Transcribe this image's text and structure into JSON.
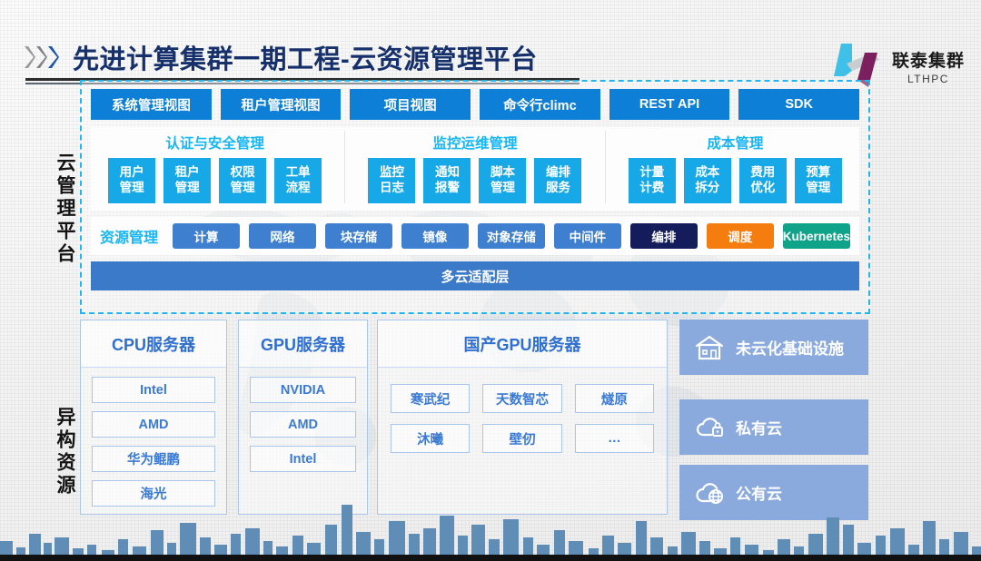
{
  "header": {
    "title": "先进计算集群一期工程-云资源管理平台",
    "chevron_icon": "double-chevron-right-icon",
    "brand_cn": "联泰集群",
    "brand_en": "LTHPC",
    "brand_logo_icon": "lthpc-logo-icon"
  },
  "side_labels": {
    "cloud_platform": "云管理平台",
    "heterogeneous": "异构资源"
  },
  "cloud_platform": {
    "top_nav": [
      {
        "label": "系统管理视图"
      },
      {
        "label": "租户管理视图"
      },
      {
        "label": "项目视图"
      },
      {
        "label": "命令行climc"
      },
      {
        "label": "REST API"
      },
      {
        "label": "SDK"
      }
    ],
    "groups": [
      {
        "title": "认证与安全管理",
        "tiles": [
          {
            "line1": "用户",
            "line2": "管理"
          },
          {
            "line1": "租户",
            "line2": "管理"
          },
          {
            "line1": "权限",
            "line2": "管理"
          },
          {
            "line1": "工单",
            "line2": "流程"
          }
        ]
      },
      {
        "title": "监控运维管理",
        "tiles": [
          {
            "line1": "监控",
            "line2": "日志"
          },
          {
            "line1": "通知",
            "line2": "报警"
          },
          {
            "line1": "脚本",
            "line2": "管理"
          },
          {
            "line1": "编排",
            "line2": "服务"
          }
        ]
      },
      {
        "title": "成本管理",
        "tiles": [
          {
            "line1": "计量",
            "line2": "计费"
          },
          {
            "line1": "成本",
            "line2": "拆分"
          },
          {
            "line1": "费用",
            "line2": "优化"
          },
          {
            "line1": "预算",
            "line2": "管理"
          }
        ]
      }
    ],
    "resource_row": {
      "title": "资源管理",
      "tiles": [
        {
          "label": "计算",
          "color": "#3f7fd0"
        },
        {
          "label": "网络",
          "color": "#3f7fd0"
        },
        {
          "label": "块存储",
          "color": "#3f7fd0"
        },
        {
          "label": "镜像",
          "color": "#3f7fd0"
        },
        {
          "label": "对象存储",
          "color": "#3f7fd0"
        },
        {
          "label": "中间件",
          "color": "#3f7fd0"
        },
        {
          "label": "编排",
          "color": "#141c5c"
        },
        {
          "label": "调度",
          "color": "#f57c0e"
        },
        {
          "label": "Kubernetes",
          "color": "#0fa389"
        }
      ]
    },
    "adaptation_layer": "多云适配层"
  },
  "heterogeneous": {
    "columns": [
      {
        "title": "CPU服务器",
        "chips": [
          "Intel",
          "AMD",
          "华为鲲鹏",
          "海光"
        ]
      },
      {
        "title": "GPU服务器",
        "chips": [
          "NVIDIA",
          "AMD",
          "Intel"
        ]
      },
      {
        "title": "国产GPU服务器",
        "chips": [
          "寒武纪",
          "天数智芯",
          "燧原",
          "沐曦",
          "壁仞",
          "…"
        ]
      }
    ],
    "cloud_cards": [
      {
        "label": "未云化基础设施",
        "icon": "building-house-icon"
      },
      {
        "label": "私有云",
        "icon": "cloud-lock-icon"
      },
      {
        "label": "公有云",
        "icon": "cloud-globe-icon"
      }
    ]
  },
  "colors": {
    "title_text": "#15306a",
    "topnav_blue": "#0e7fd6",
    "group_title_cyan": "#17b6f5",
    "group_tile_blue": "#17a8e8",
    "adapt_blue": "#3b79c9",
    "cloud_card_blue": "#8aa9dd",
    "dashed_border": "#22b6ef",
    "skyline": "#5f8db5"
  }
}
